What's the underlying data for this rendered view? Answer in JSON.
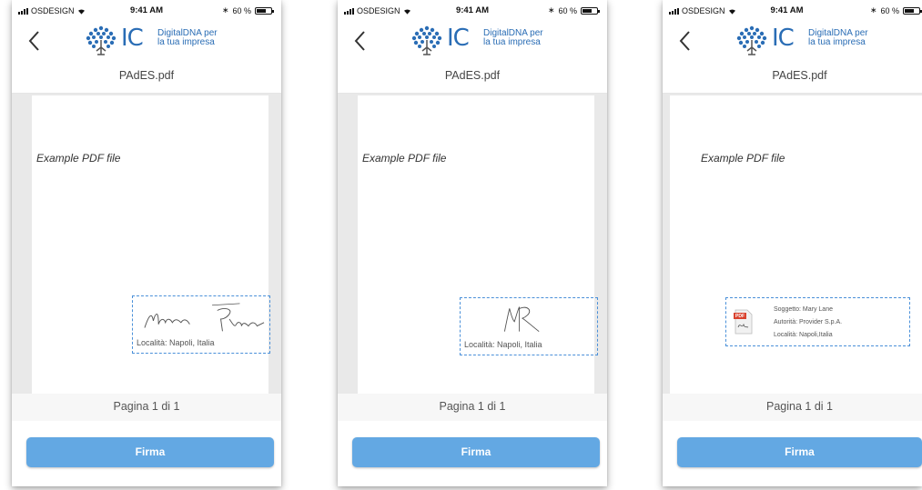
{
  "status": {
    "carrier": "OSDESIGN",
    "time": "9:41 AM",
    "battery_text": "60 %",
    "battery_level": 0.6
  },
  "brand": {
    "mark": "IC",
    "line1": "DigitalDNA per",
    "line2": "la tua impresa",
    "color": "#2a6db5"
  },
  "file": {
    "name": "PAdES.pdf"
  },
  "document": {
    "title": "Example PDF file"
  },
  "pagination": {
    "label": "Pagina 1 di 1"
  },
  "actions": {
    "sign_label": "Firma"
  },
  "screens": [
    {
      "signature": {
        "kind": "handwritten-full-name",
        "location": "Località: Napoli, Italia"
      }
    },
    {
      "signature": {
        "kind": "handwritten-initials",
        "location": "Località: Napoli, Italia"
      }
    },
    {
      "signature": {
        "kind": "certificate",
        "subject": "Soggetto: Mary Lane",
        "authority": "Autorità: Provider S.p.A.",
        "location": "Località: Napoli,Italia",
        "badge": "PDF"
      }
    }
  ],
  "colors": {
    "accent": "#63a8e3",
    "signature_border": "#4a90d9",
    "brand": "#2a6db5"
  }
}
